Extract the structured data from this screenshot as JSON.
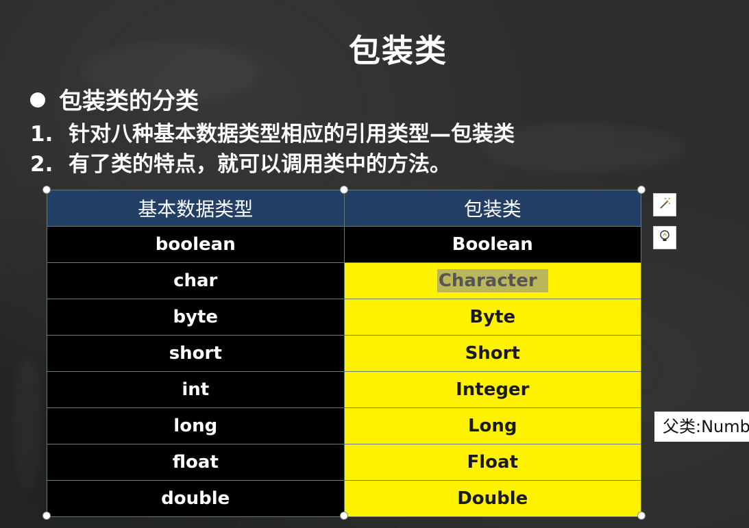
{
  "slide": {
    "title": "包装类",
    "bullet": "包装类的分类",
    "lines": [
      {
        "num": "1.",
        "text": "针对八种基本数据类型相应的引用类型—包装类"
      },
      {
        "num": "2.",
        "text": "有了类的特点，就可以调用类中的方法。"
      }
    ]
  },
  "table": {
    "headers": [
      "基本数据类型",
      "包装类"
    ],
    "rows": [
      {
        "primitive": "boolean",
        "wrapper": "Boolean"
      },
      {
        "primitive": "char",
        "wrapper": "Character"
      },
      {
        "primitive": "byte",
        "wrapper": "Byte"
      },
      {
        "primitive": "short",
        "wrapper": "Short"
      },
      {
        "primitive": "int",
        "wrapper": "Integer"
      },
      {
        "primitive": "long",
        "wrapper": "Long"
      },
      {
        "primitive": "float",
        "wrapper": "Float"
      },
      {
        "primitive": "double",
        "wrapper": "Double"
      }
    ]
  },
  "note": {
    "text": "父类:Numb"
  },
  "colors": {
    "header_bg": "#233f66",
    "highlight_yellow": "#fff200",
    "cell_black": "#000000",
    "background": "#2b2c2c"
  },
  "side_tools": {
    "design_icon": "magic-wand-icon",
    "ideas_icon": "lightbulb-icon"
  }
}
